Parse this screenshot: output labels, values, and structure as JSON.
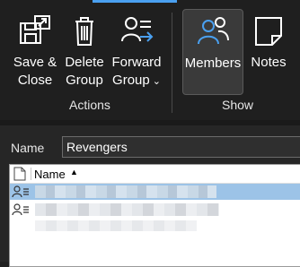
{
  "ribbon": {
    "actions_group_label": "Actions",
    "show_group_label": "Show",
    "buttons": {
      "save_close": "Save &\nClose",
      "delete_group": "Delete\nGroup",
      "forward_group": "Forward\nGroup",
      "members": "Members",
      "notes": "Notes"
    },
    "selected": "Members",
    "accent_color": "#4aa0f0"
  },
  "form": {
    "name_label": "Name",
    "name_value": "Revengers"
  },
  "members_list": {
    "column_header": "Name",
    "sort_indicator": "▲",
    "rows": [
      {
        "display": "",
        "selected": true
      },
      {
        "display": "",
        "selected": false
      }
    ]
  }
}
